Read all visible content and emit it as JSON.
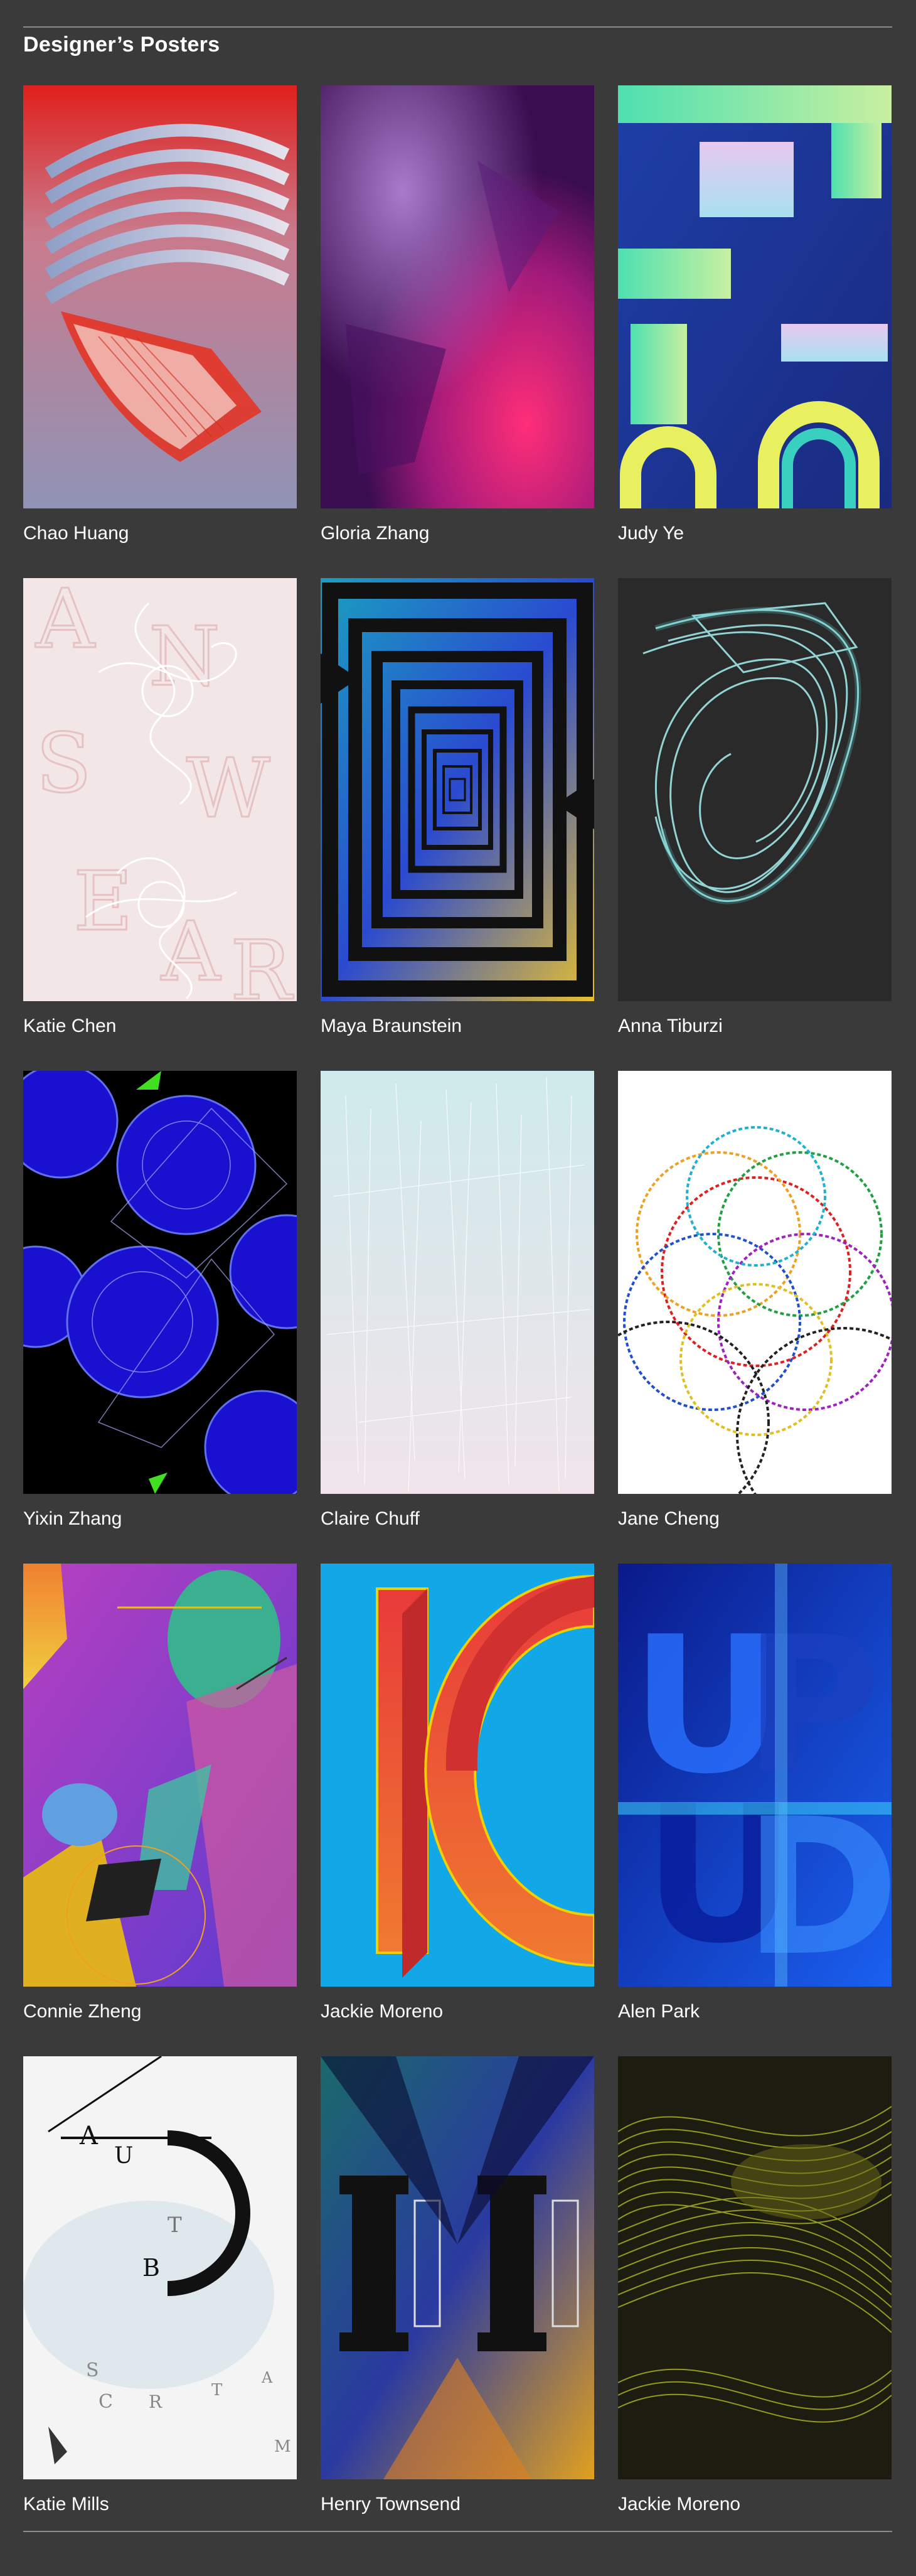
{
  "header": {
    "title": "Designer’s Posters"
  },
  "posters": [
    {
      "designer": "Chao Huang"
    },
    {
      "designer": "Gloria Zhang"
    },
    {
      "designer": "Judy Ye"
    },
    {
      "designer": "Katie Chen"
    },
    {
      "designer": "Maya Braunstein"
    },
    {
      "designer": "Anna Tiburzi"
    },
    {
      "designer": "Yixin Zhang"
    },
    {
      "designer": "Claire Chuff"
    },
    {
      "designer": "Jane Cheng"
    },
    {
      "designer": "Connie Zheng"
    },
    {
      "designer": "Jackie Moreno"
    },
    {
      "designer": "Alen Park"
    },
    {
      "designer": "Katie Mills"
    },
    {
      "designer": "Henry Townsend"
    },
    {
      "designer": "Jackie Moreno"
    }
  ],
  "colors": {
    "page_background": "#3a3a3a",
    "rule": "#8a8a8a",
    "text": "#ffffff"
  }
}
